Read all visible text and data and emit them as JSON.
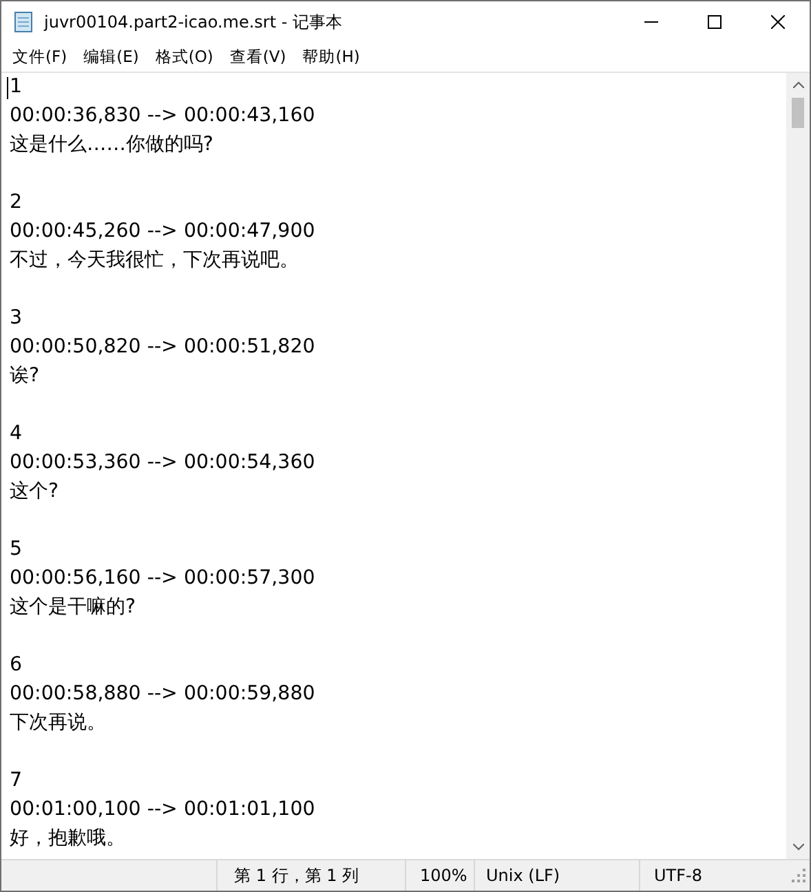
{
  "window": {
    "title": "juvr00104.part2-icao.me.srt - 记事本"
  },
  "menu": [
    "文件(F)",
    "编辑(E)",
    "格式(O)",
    "查看(V)",
    "帮助(H)"
  ],
  "subtitles": [
    {
      "index": "1",
      "timing": "00:00:36,830 --> 00:00:43,160",
      "text": "这是什么……你做的吗?"
    },
    {
      "index": "2",
      "timing": "00:00:45,260 --> 00:00:47,900",
      "text": "不过，今天我很忙，下次再说吧。"
    },
    {
      "index": "3",
      "timing": "00:00:50,820 --> 00:00:51,820",
      "text": "诶?"
    },
    {
      "index": "4",
      "timing": "00:00:53,360 --> 00:00:54,360",
      "text": "这个?"
    },
    {
      "index": "5",
      "timing": "00:00:56,160 --> 00:00:57,300",
      "text": "这个是干嘛的?"
    },
    {
      "index": "6",
      "timing": "00:00:58,880 --> 00:00:59,880",
      "text": "下次再说。"
    },
    {
      "index": "7",
      "timing": "00:01:00,100 --> 00:01:01,100",
      "text": "好，抱歉哦。"
    }
  ],
  "status_bar": {
    "position": "第 1 行，第 1 列",
    "zoom": "100%",
    "line_ending": "Unix (LF)",
    "encoding": "UTF-8"
  }
}
